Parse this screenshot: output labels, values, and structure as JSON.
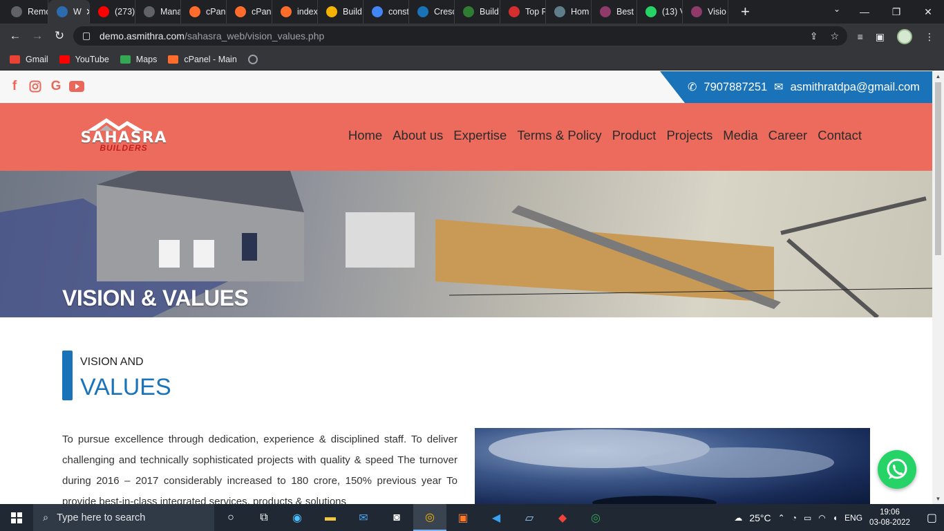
{
  "browser": {
    "tabs": [
      {
        "label": "Remo",
        "color": "#5f6368"
      },
      {
        "label": "W",
        "color": "#2b6cb0",
        "active": true
      },
      {
        "label": "(273)",
        "color": "#ff0000"
      },
      {
        "label": "Mana",
        "color": "#5f6368"
      },
      {
        "label": "cPane",
        "color": "#ff6c2c"
      },
      {
        "label": "cPane",
        "color": "#ff6c2c"
      },
      {
        "label": "index",
        "color": "#ff6c2c"
      },
      {
        "label": "Build",
        "color": "#f4b400"
      },
      {
        "label": "const",
        "color": "#4285f4"
      },
      {
        "label": "Cresc",
        "color": "#1a73b8"
      },
      {
        "label": "Build",
        "color": "#2e7d32"
      },
      {
        "label": "Top F",
        "color": "#d32f2f"
      },
      {
        "label": "Hom",
        "color": "#607d8b"
      },
      {
        "label": "Best",
        "color": "#8e3b6a"
      },
      {
        "label": "(13) V",
        "color": "#25d366"
      },
      {
        "label": "Visio",
        "color": "#8e3b6a"
      }
    ],
    "url_host": "demo.asmithra.com",
    "url_path": "/sahasra_web/vision_values.php",
    "bookmarks": [
      {
        "label": "Gmail",
        "color": "#ea4335"
      },
      {
        "label": "YouTube",
        "color": "#ff0000"
      },
      {
        "label": "Maps",
        "color": "#34a853"
      },
      {
        "label": "cPanel - Main",
        "color": "#ff6c2c"
      }
    ]
  },
  "site": {
    "phone": "7907887251",
    "email": "asmithratdpa@gmail.com",
    "logo_top": "SAHASRA",
    "logo_bottom": "BUILDERS",
    "nav": [
      "Home",
      "About us",
      "Expertise",
      "Terms & Policy",
      "Product",
      "Projects",
      "Media",
      "Career",
      "Contact"
    ],
    "hero_title": "VISION & VALUES",
    "section_small": "VISION AND",
    "section_big": "VALUES",
    "paragraph": "To pursue excellence through dedication, experience & disciplined staff. To deliver challenging and technically sophisticated projects with quality & speed The turnover during 2016 – 2017 considerably increased to 180 crore, 150% previous year To provide best-in-class integrated services, products & solutions",
    "colors": {
      "accent": "#ec6b5c",
      "blue": "#1a73b8"
    }
  },
  "taskbar": {
    "search_placeholder": "Type here to search",
    "weather": "25°C",
    "lang": "ENG",
    "time": "19:06",
    "date": "03-08-2022"
  }
}
